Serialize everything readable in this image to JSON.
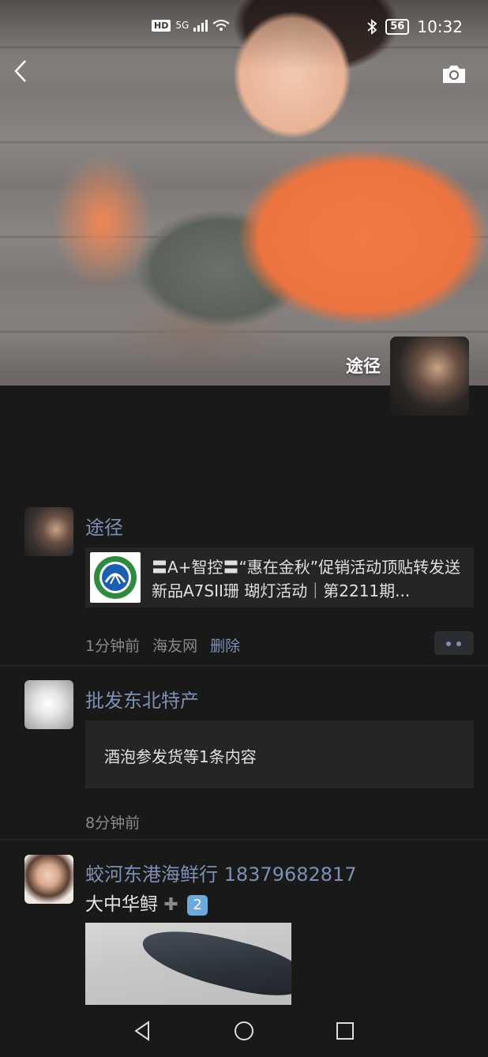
{
  "status_bar": {
    "network_hd": "HD",
    "network_type": "5G",
    "battery": "56",
    "time": "10:32"
  },
  "cover": {
    "owner_name": "途径"
  },
  "posts": [
    {
      "name": "途径",
      "share_title": "〓A+智控〓“惠在金秋”促销活动顶贴转发送新品A7SII珊 瑚灯活动｜第2211期...",
      "time": "1分钟前",
      "source": "海友网",
      "delete_label": "删除"
    },
    {
      "name": "批发东北特产",
      "text_card": "酒泡参发货等1条内容",
      "time": "8分钟前"
    },
    {
      "name": "蛟河东港海鲜行  18379682817",
      "text": "大中华鲟",
      "badge": "2"
    }
  ],
  "icons": {
    "back": "back-arrow-icon",
    "camera": "camera-icon",
    "nav_back": "nav-back-icon",
    "nav_home": "nav-home-icon",
    "nav_recent": "nav-recent-icon"
  },
  "colors": {
    "background": "#191919",
    "link_name": "#7d90b4",
    "meta": "#8a8a8a"
  }
}
